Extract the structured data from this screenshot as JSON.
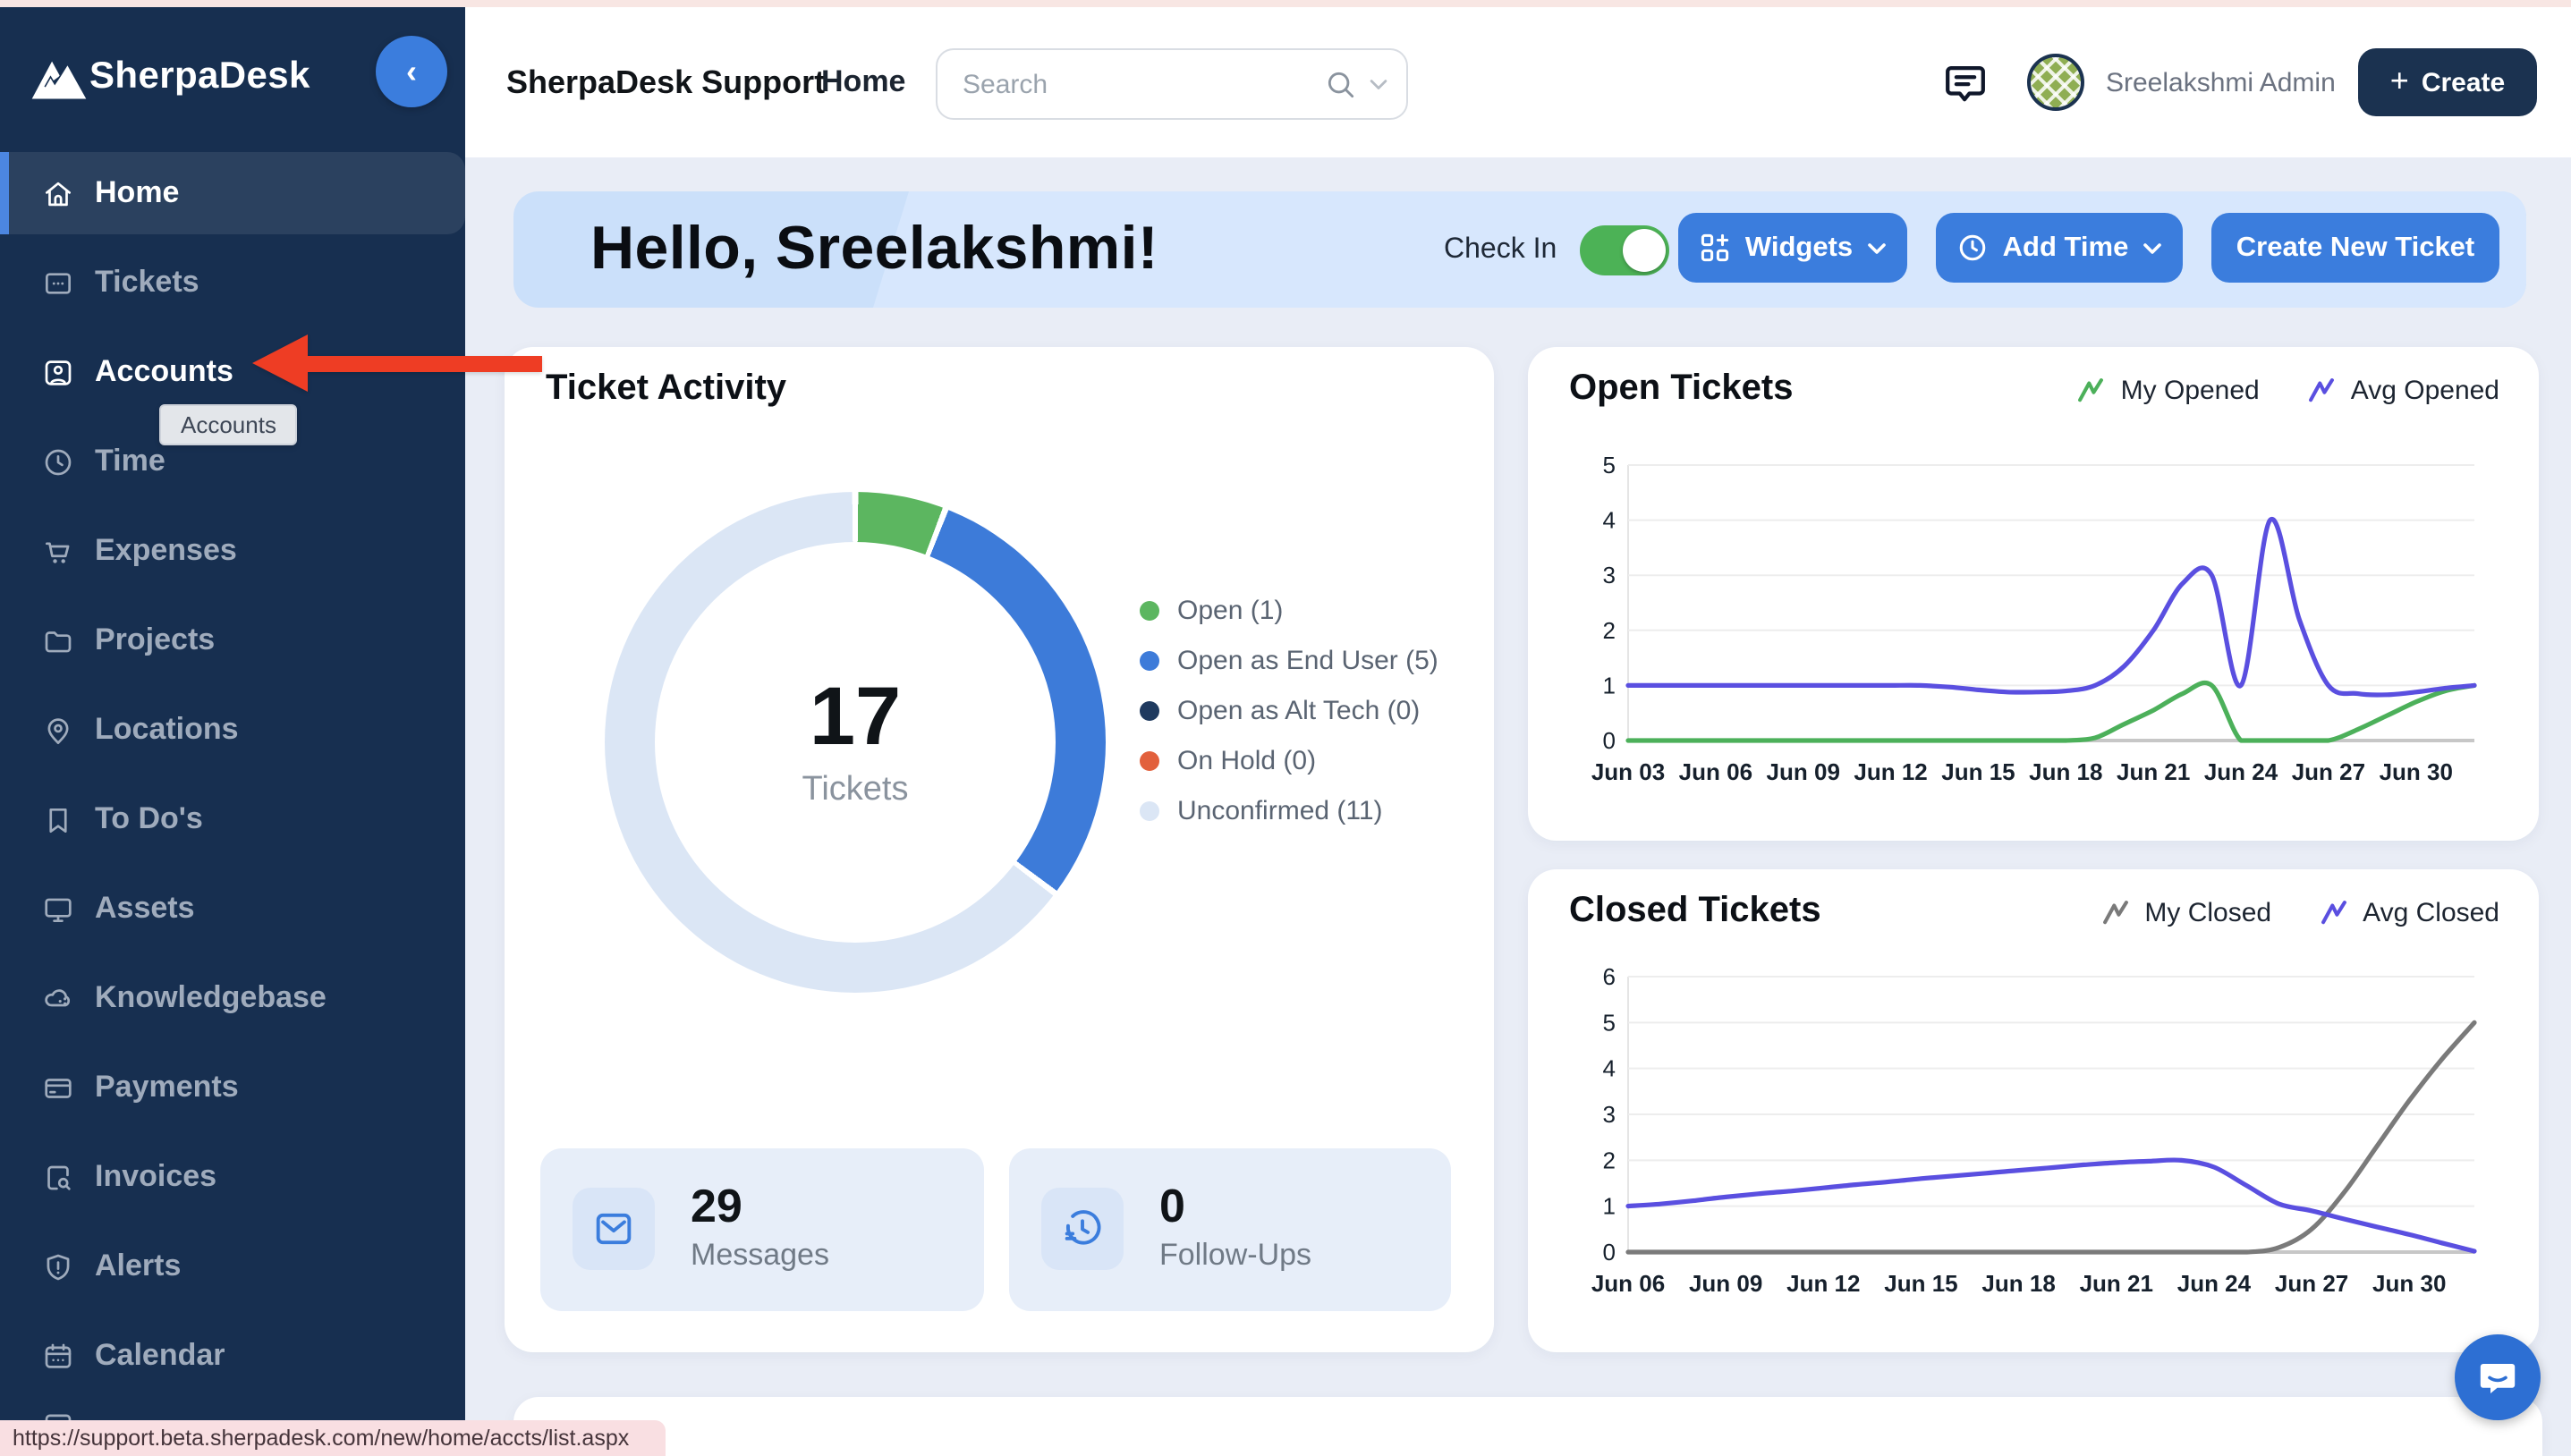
{
  "window": {
    "status_url": "https://support.beta.sherpadesk.com/new/home/accts/list.aspx"
  },
  "sidebar": {
    "logo_text": "SherpaDesk",
    "tooltip": "Accounts",
    "items": [
      {
        "label": "Home",
        "icon": "home",
        "active": true
      },
      {
        "label": "Tickets",
        "icon": "ticket"
      },
      {
        "label": "Accounts",
        "icon": "accounts",
        "highlighted": true
      },
      {
        "label": "Time",
        "icon": "clock"
      },
      {
        "label": "Expenses",
        "icon": "cart"
      },
      {
        "label": "Projects",
        "icon": "folder"
      },
      {
        "label": "Locations",
        "icon": "pin"
      },
      {
        "label": "To Do's",
        "icon": "bookmark"
      },
      {
        "label": "Assets",
        "icon": "monitor"
      },
      {
        "label": "Knowledgebase",
        "icon": "cloud"
      },
      {
        "label": "Payments",
        "icon": "card"
      },
      {
        "label": "Invoices",
        "icon": "invoice"
      },
      {
        "label": "Alerts",
        "icon": "shield"
      },
      {
        "label": "Calendar",
        "icon": "calendar"
      }
    ]
  },
  "topbar": {
    "brand": "SherpaDesk Support",
    "nav_home": "Home",
    "search_placeholder": "Search",
    "user_name": "Sreelakshmi Admin",
    "create_label": "Create",
    "create_plus": "+"
  },
  "banner": {
    "greeting": "Hello, Sreelakshmi!",
    "check_in_label": "Check In",
    "check_in_on": true,
    "widgets_label": "Widgets",
    "add_time_label": "Add Time",
    "create_ticket_label": "Create New Ticket"
  },
  "ticket_activity": {
    "title": "Ticket Activity",
    "center_value": "17",
    "center_label": "Tickets",
    "legend": [
      {
        "label": "Open",
        "count": 1,
        "color": "#5cb660"
      },
      {
        "label": "Open as End User",
        "count": 5,
        "color": "#3d7bd9"
      },
      {
        "label": "Open as Alt Tech",
        "count": 0,
        "color": "#1f3a5f"
      },
      {
        "label": "On Hold",
        "count": 0,
        "color": "#e2603c"
      },
      {
        "label": "Unconfirmed",
        "count": 11,
        "color": "#dbe6f5"
      }
    ],
    "stats": [
      {
        "value": "29",
        "label": "Messages",
        "icon": "mail"
      },
      {
        "value": "0",
        "label": "Follow-Ups",
        "icon": "clock-history"
      }
    ]
  },
  "chart_data": [
    {
      "type": "line",
      "title": "Open Tickets",
      "xlabel": "",
      "ylabel": "",
      "ylim": [
        0,
        5
      ],
      "grid": true,
      "legend_position": "top-right",
      "x_tick_labels": [
        "Jun 03",
        "Jun 06",
        "Jun 09",
        "Jun 12",
        "Jun 15",
        "Jun 18",
        "Jun 21",
        "Jun 24",
        "Jun 27",
        "Jun 30"
      ],
      "tick_step": 3,
      "n_points": 30,
      "series": [
        {
          "name": "My Opened",
          "color": "#4cb05a",
          "values": [
            0,
            0,
            0,
            0,
            0,
            0,
            0,
            0,
            0,
            0,
            0,
            0,
            0,
            0,
            0,
            0,
            0.05,
            0.3,
            0.55,
            0.85,
            1.0,
            0,
            0,
            0,
            0,
            0.2,
            0.45,
            0.7,
            0.9,
            1.0
          ]
        },
        {
          "name": "Avg Opened",
          "color": "#5a4fe0",
          "values": [
            1,
            1,
            1,
            1,
            1,
            1,
            1,
            1,
            1,
            1,
            1,
            0.97,
            0.92,
            0.88,
            0.88,
            0.9,
            1.0,
            1.35,
            2.0,
            2.85,
            3.0,
            1.0,
            4.0,
            2.2,
            1.0,
            0.85,
            0.83,
            0.88,
            0.95,
            1.0
          ]
        }
      ]
    },
    {
      "type": "line",
      "title": "Closed Tickets",
      "xlabel": "",
      "ylabel": "",
      "ylim": [
        0,
        6
      ],
      "grid": true,
      "legend_position": "top-right",
      "x_tick_labels": [
        "Jun 06",
        "Jun 09",
        "Jun 12",
        "Jun 15",
        "Jun 18",
        "Jun 21",
        "Jun 24",
        "Jun 27",
        "Jun 30"
      ],
      "tick_step": 3,
      "n_points": 27,
      "series": [
        {
          "name": "My Closed",
          "color": "#7a7a7a",
          "values": [
            0,
            0,
            0,
            0,
            0,
            0,
            0,
            0,
            0,
            0,
            0,
            0,
            0,
            0,
            0,
            0,
            0,
            0,
            0,
            0,
            0.1,
            0.5,
            1.3,
            2.3,
            3.3,
            4.2,
            5.0
          ]
        },
        {
          "name": "Avg Closed",
          "color": "#5a4fe0",
          "values": [
            1.0,
            1.05,
            1.12,
            1.2,
            1.27,
            1.33,
            1.4,
            1.47,
            1.53,
            1.6,
            1.66,
            1.72,
            1.78,
            1.84,
            1.9,
            1.95,
            1.98,
            2.0,
            1.85,
            1.45,
            1.05,
            0.9,
            0.72,
            0.55,
            0.38,
            0.2,
            0.02
          ]
        }
      ]
    }
  ],
  "colors": {
    "primary_blue": "#3b7ddd",
    "navy": "#1b3250",
    "toggle_green": "#4cb256",
    "arrow_red": "#ee3d24",
    "sidebar_bg": "#172f50",
    "main_bg": "#e9edf6"
  }
}
